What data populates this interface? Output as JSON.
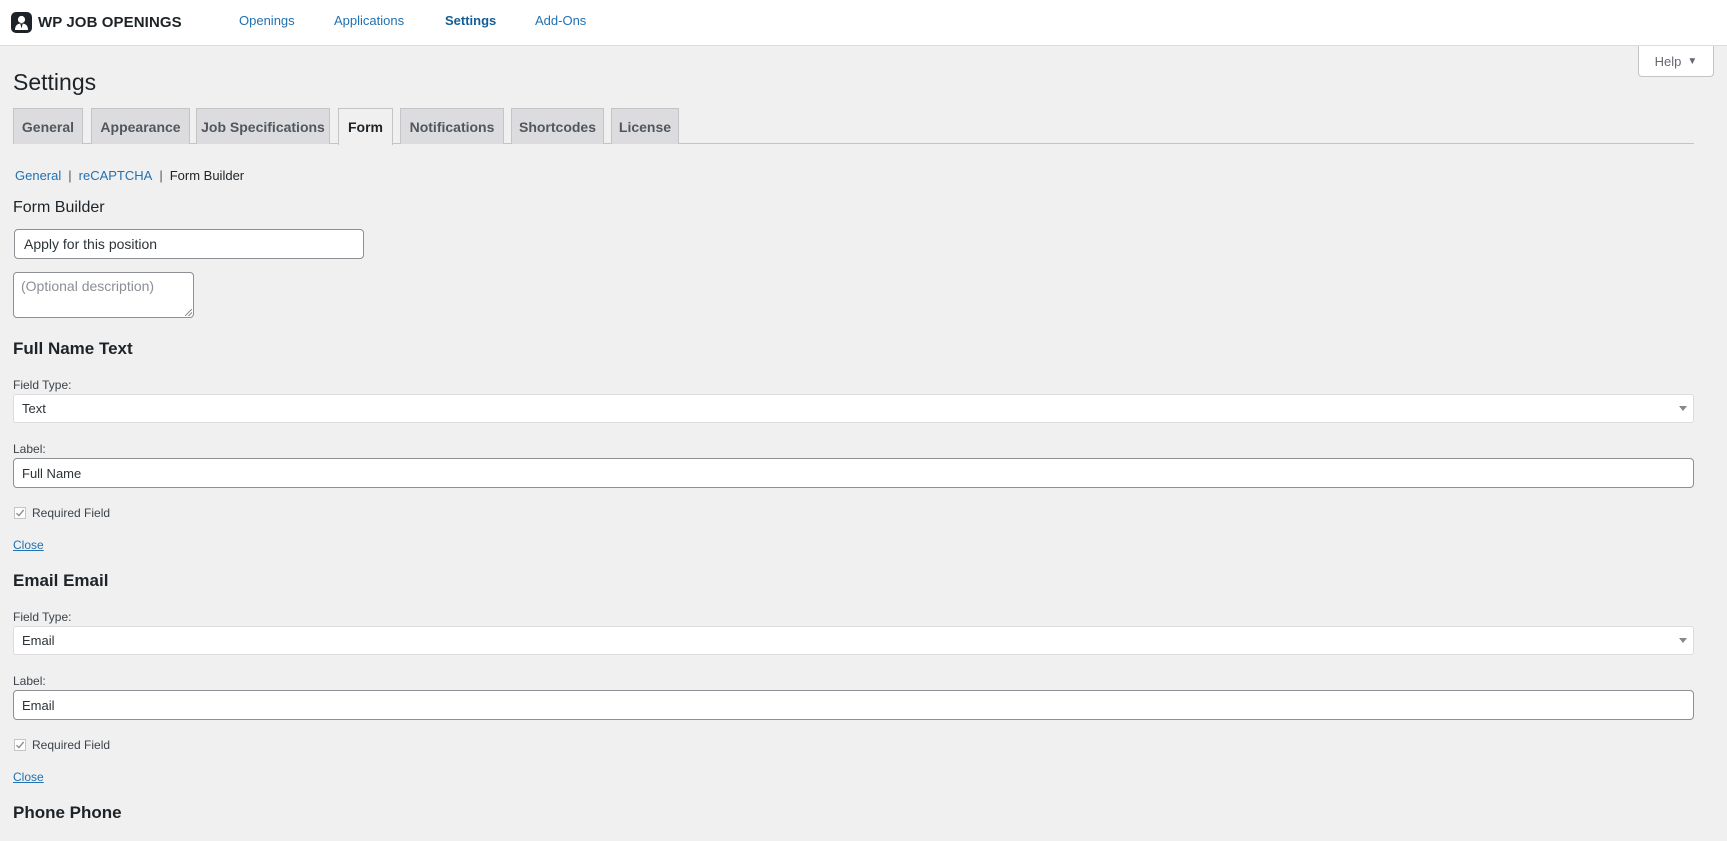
{
  "topbar": {
    "brand": "WP JOB OPENINGS",
    "nav": [
      "Openings",
      "Applications",
      "Settings",
      "Add-Ons"
    ],
    "active_nav": "Settings"
  },
  "help": {
    "label": "Help",
    "caret": "▼"
  },
  "page_title": "Settings",
  "tabs": [
    "General",
    "Appearance",
    "Job Specifications",
    "Form",
    "Notifications",
    "Shortcodes",
    "License"
  ],
  "active_tab": "Form",
  "subnav": {
    "items": [
      "General",
      "reCAPTCHA",
      "Form Builder"
    ],
    "separator": "|",
    "current": "Form Builder"
  },
  "form_builder": {
    "heading": "Form Builder",
    "form_title_value": "Apply for this position",
    "description_placeholder": "(Optional description)"
  },
  "fields": [
    {
      "heading": "Full Name Text",
      "field_type_label": "Field Type:",
      "field_type_value": "Text",
      "label_label": "Label:",
      "label_value": "Full Name",
      "required_label": "Required Field",
      "required_checked": true,
      "close_label": "Close"
    },
    {
      "heading": "Email Email",
      "field_type_label": "Field Type:",
      "field_type_value": "Email",
      "label_label": "Label:",
      "label_value": "Email",
      "required_label": "Required Field",
      "required_checked": true,
      "close_label": "Close"
    },
    {
      "heading": "Phone Phone"
    }
  ],
  "colors": {
    "link": "#2271b1",
    "background": "#f0f0f1",
    "tab_inactive": "#dcdcde"
  }
}
